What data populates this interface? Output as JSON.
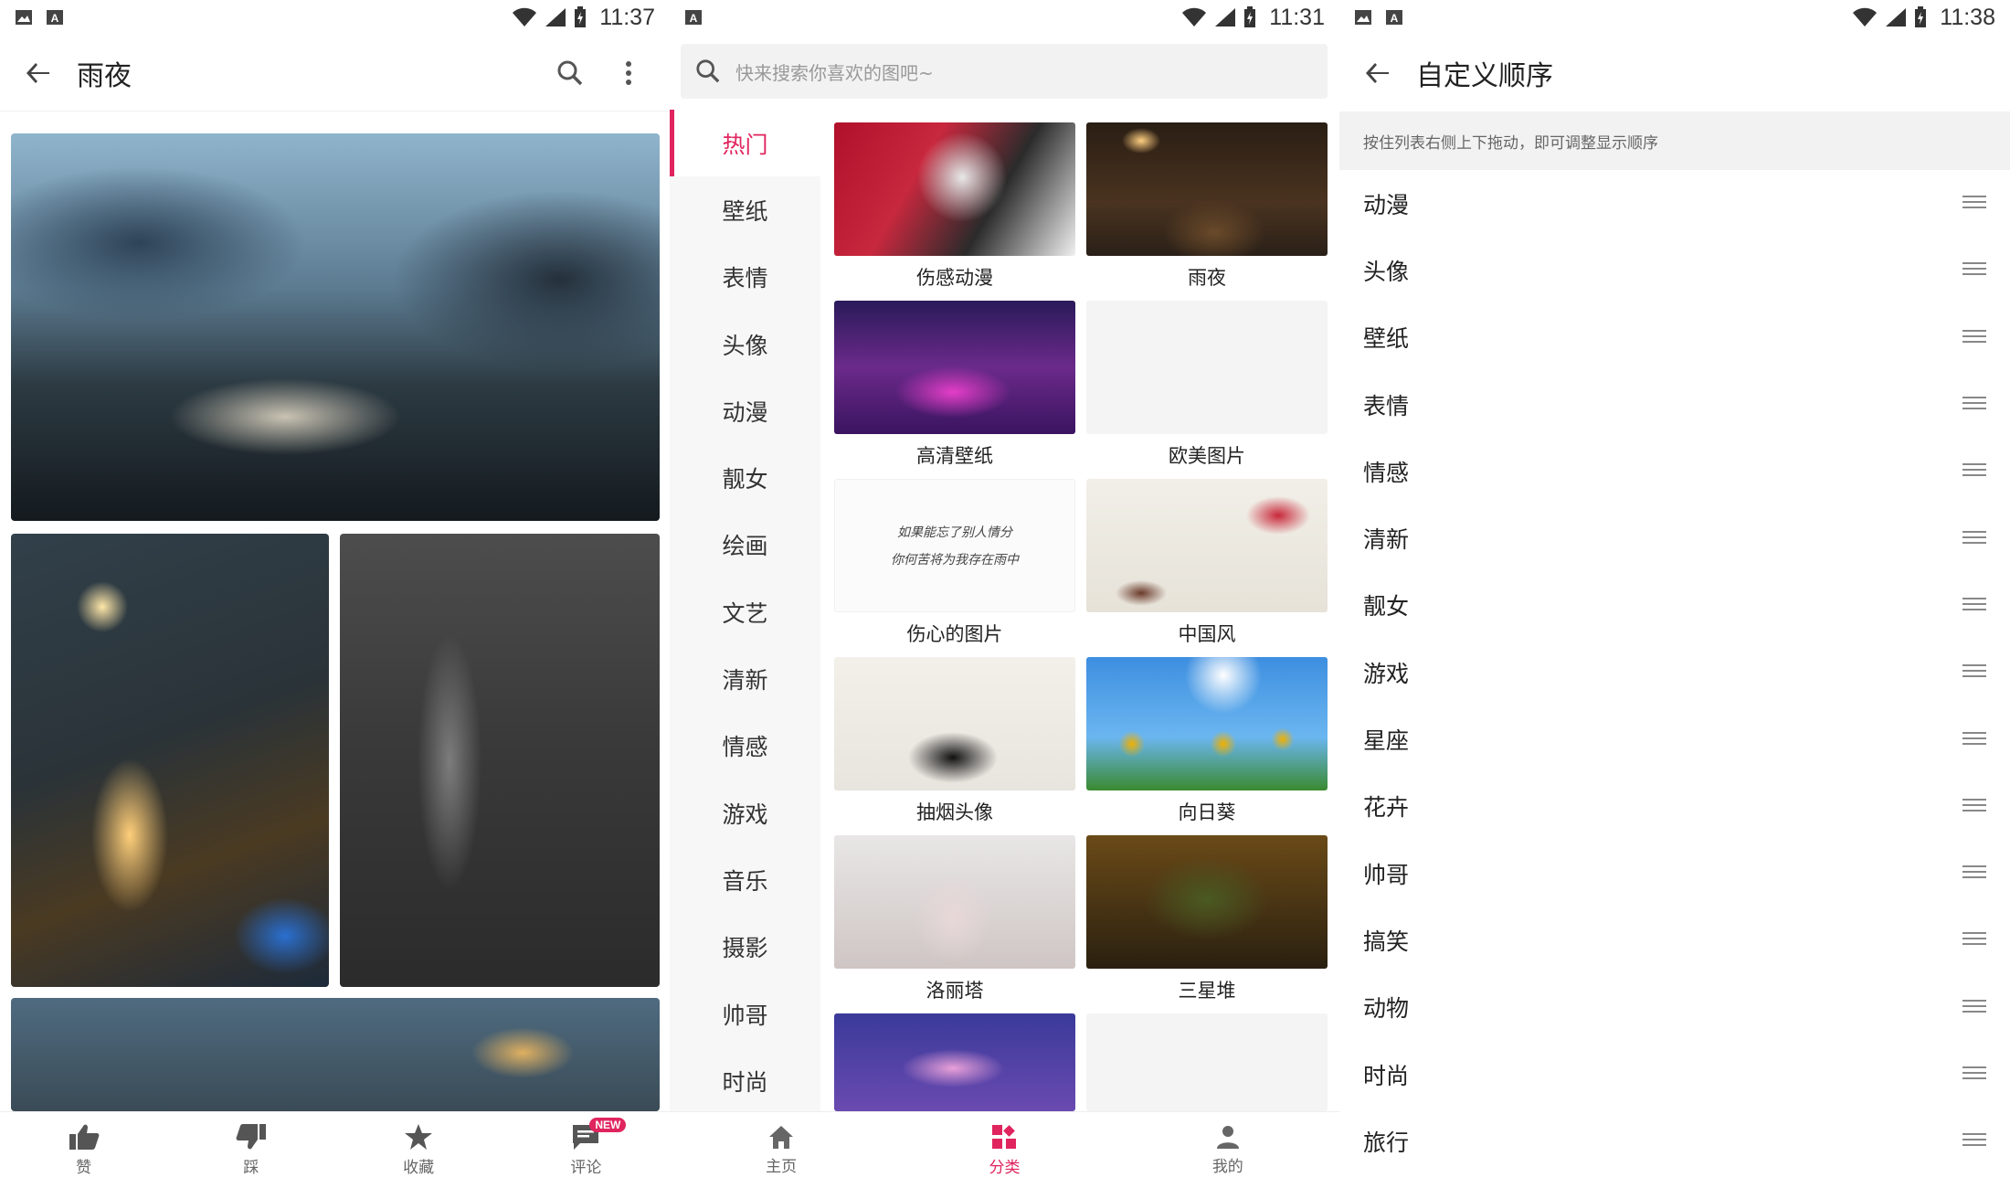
{
  "status": {
    "s1_time": "11:37",
    "s2_time": "11:31",
    "s3_time": "11:38"
  },
  "detail": {
    "title": "雨夜",
    "actions": [
      "赞",
      "踩",
      "收藏",
      "评论"
    ],
    "new_badge": "NEW"
  },
  "category": {
    "search_placeholder": "快来搜索你喜欢的图吧~",
    "sidebar": [
      "热门",
      "壁纸",
      "表情",
      "头像",
      "动漫",
      "靓女",
      "绘画",
      "文艺",
      "清新",
      "情感",
      "游戏",
      "音乐",
      "摄影",
      "帅哥",
      "时尚"
    ],
    "active_index": 0,
    "tiles": [
      "伤感动漫",
      "雨夜",
      "高清壁纸",
      "欧美图片",
      "伤心的图片",
      "中国风",
      "抽烟头像",
      "向日葵",
      "洛丽塔",
      "三星堆"
    ],
    "calligraphy_line1": "如果能忘了别人情分",
    "calligraphy_line2": "你何苦将为我存在雨中",
    "nav": [
      "主页",
      "分类",
      "我的"
    ],
    "nav_active": 1
  },
  "order": {
    "title": "自定义顺序",
    "hint": "按住列表右侧上下拖动，即可调整显示顺序",
    "items": [
      "动漫",
      "头像",
      "壁纸",
      "表情",
      "情感",
      "清新",
      "靓女",
      "游戏",
      "星座",
      "花卉",
      "帅哥",
      "搞笑",
      "动物",
      "时尚",
      "旅行"
    ]
  },
  "colors": {
    "accent": "#e0245e",
    "text": "#222222",
    "muted": "#666666",
    "sidebar_bg": "#f7f7f7"
  },
  "icons": {
    "back": "arrow-left-icon",
    "search": "search-icon",
    "more": "more-vert-icon",
    "drag": "drag-handle-icon",
    "like": "thumb-up-icon",
    "dislike": "thumb-down-icon",
    "favorite": "star-icon",
    "comment": "comment-icon",
    "home": "home-icon",
    "category": "category-icon",
    "mine": "person-icon"
  }
}
